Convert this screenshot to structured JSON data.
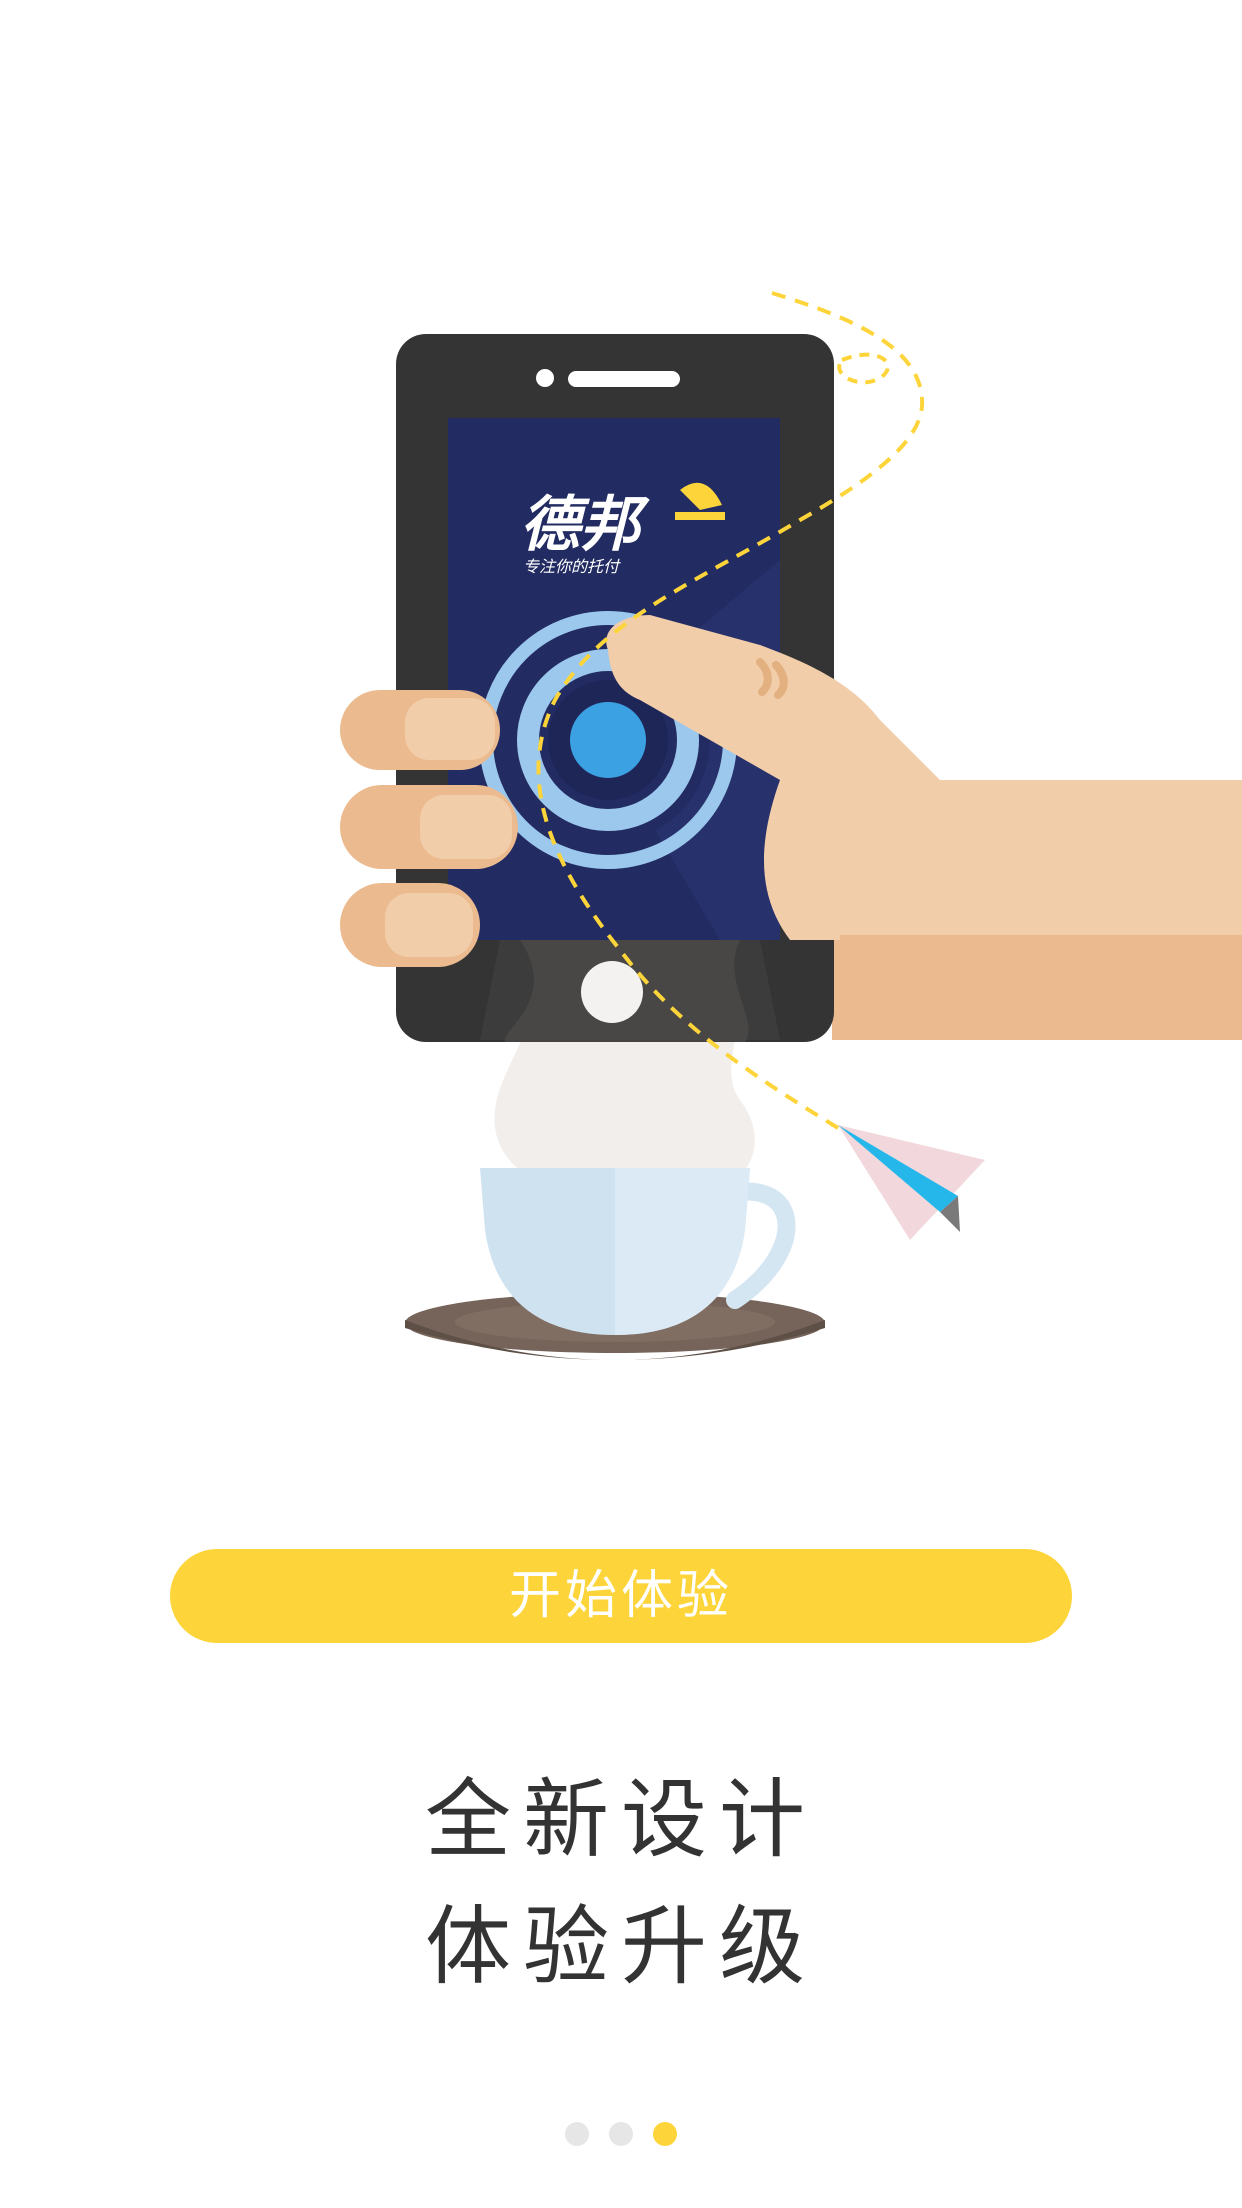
{
  "illustration": {
    "brand_logo": "德邦",
    "brand_slogan": "专注你的托付"
  },
  "start_button": {
    "label": "开始体验",
    "color": "#FDD53A"
  },
  "headline": {
    "line1": "全新设计",
    "line2": "体验升级"
  },
  "pager": {
    "total": 3,
    "active_index": 2,
    "active_color": "#FDD53A",
    "inactive_color": "#E6E6E6"
  },
  "colors": {
    "phone_body": "#343434",
    "screen_bg": "#222B62",
    "skin_light": "#F1CDAA",
    "skin_dark": "#EBBB8F",
    "cup": "#CFE2F0",
    "saucer": "#76645A",
    "ring": "#9BC8EC",
    "button_dot": "#3CA1E2"
  }
}
